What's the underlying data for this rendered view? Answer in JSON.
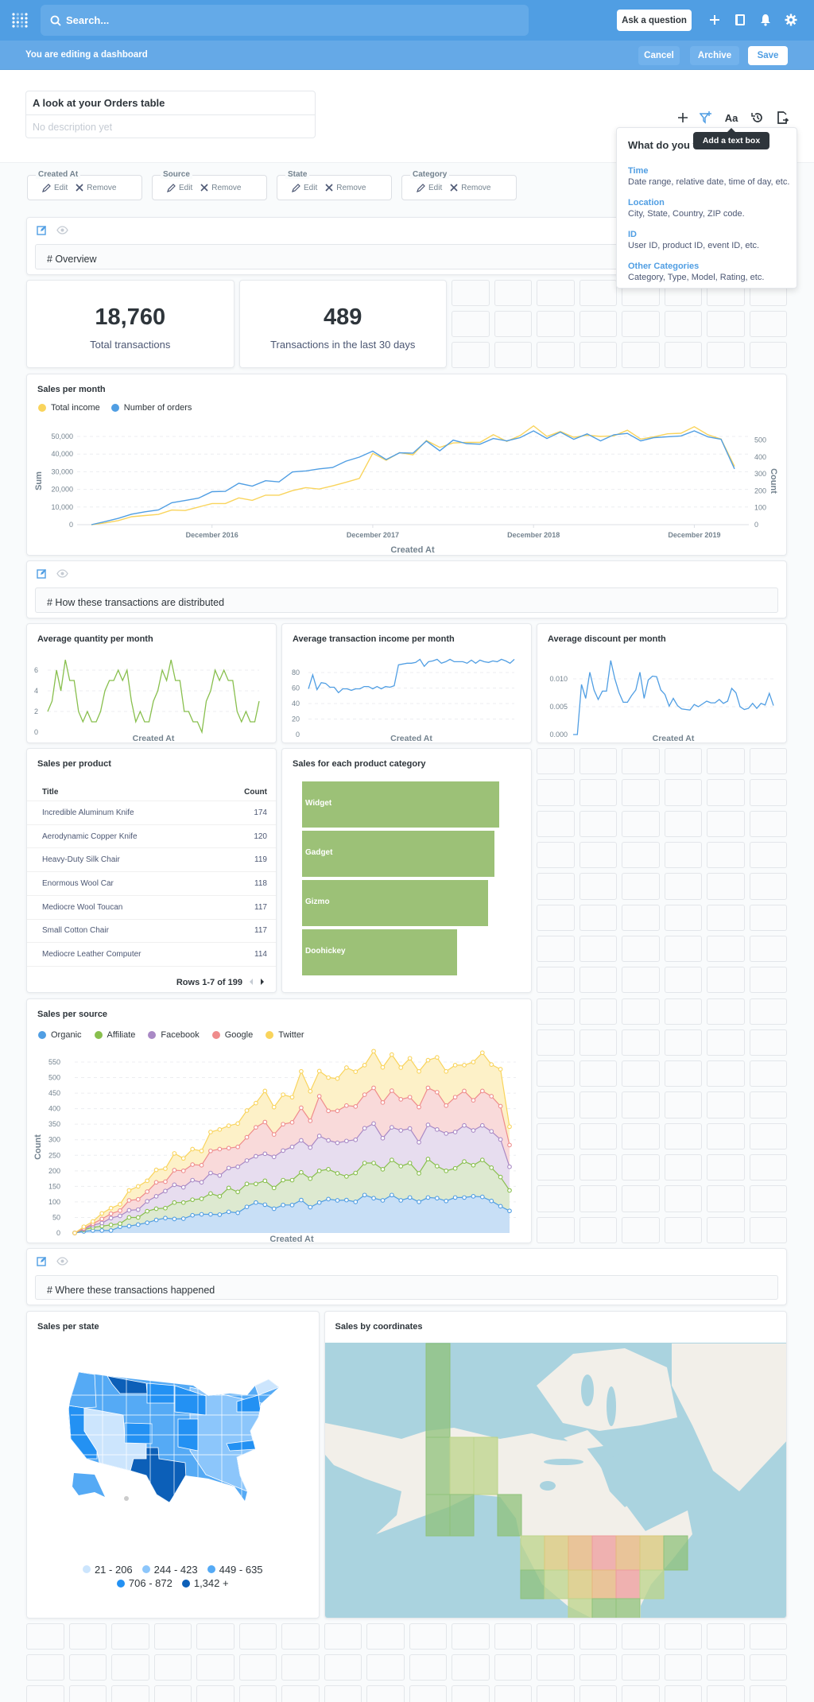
{
  "nav": {
    "search_placeholder": "Search...",
    "ask_button": "Ask a question",
    "icons": [
      "metabase-logo-icon",
      "search-icon",
      "plus-icon",
      "book-icon",
      "bell-icon",
      "gear-icon"
    ]
  },
  "editbar": {
    "message": "You are editing a dashboard",
    "cancel": "Cancel",
    "archive": "Archive",
    "save": "Save"
  },
  "dashboard": {
    "title": "A look at your Orders table",
    "description_placeholder": "No description yet"
  },
  "toolbar": {
    "icons": [
      "plus-icon",
      "add-filter-icon",
      "text-box-icon",
      "history-icon",
      "export-icon"
    ],
    "tooltip": "Add a text box"
  },
  "popover": {
    "heading": "What do you w",
    "options": [
      {
        "label": "Time",
        "desc": "Date range, relative date, time of day, etc."
      },
      {
        "label": "Location",
        "desc": "City, State, Country, ZIP code."
      },
      {
        "label": "ID",
        "desc": "User ID, product ID, event ID, etc."
      },
      {
        "label": "Other Categories",
        "desc": "Category, Type, Model, Rating, etc."
      }
    ]
  },
  "filters": {
    "edit_label": "Edit",
    "remove_label": "Remove",
    "items": [
      {
        "label": "Created At"
      },
      {
        "label": "Source"
      },
      {
        "label": "State"
      },
      {
        "label": "Category"
      }
    ]
  },
  "text_cards": [
    {
      "text": "# Overview"
    },
    {
      "text": "# How these transactions are distributed"
    },
    {
      "text": "# Where these transactions happened"
    }
  ],
  "scalars": [
    {
      "value": "18,760",
      "label": "Total transactions"
    },
    {
      "value": "489",
      "label": "Transactions in the last 30 days"
    }
  ],
  "colors": {
    "brand": "#509ee3",
    "yellow": "#f9d45c",
    "green": "#88bf4d",
    "purple": "#a989c5",
    "red": "#ef8c8c"
  },
  "chart_data": [
    {
      "title": "Sales per month",
      "type": "line",
      "x": [
        "2016-03",
        "2016-04",
        "2016-05",
        "2016-06",
        "2016-07",
        "2016-08",
        "2016-09",
        "2016-10",
        "2016-11",
        "2016-12",
        "2017-01",
        "2017-02",
        "2017-03",
        "2017-04",
        "2017-05",
        "2017-06",
        "2017-07",
        "2017-08",
        "2017-09",
        "2017-10",
        "2017-11",
        "2017-12",
        "2018-01",
        "2018-02",
        "2018-03",
        "2018-04",
        "2018-05",
        "2018-06",
        "2018-07",
        "2018-08",
        "2018-09",
        "2018-10",
        "2018-11",
        "2018-12",
        "2019-01",
        "2019-02",
        "2019-03",
        "2019-04",
        "2019-05",
        "2019-06",
        "2019-07",
        "2019-08",
        "2019-09",
        "2019-10",
        "2019-11",
        "2019-12",
        "2020-01",
        "2020-02",
        "2020-03"
      ],
      "xticks": [
        "December 2016",
        "December 2017",
        "December 2018",
        "December 2019"
      ],
      "xlabel": "Created At",
      "ylabel": "Sum",
      "y2label": "Count",
      "yticks": [
        "0",
        "10,000",
        "20,000",
        "30,000",
        "40,000",
        "50,000"
      ],
      "y2ticks": [
        "0",
        "100",
        "200",
        "300",
        "400",
        "500"
      ],
      "legend": "top-left",
      "series": [
        {
          "name": "Total income",
          "color": "#f9d45c",
          "axis": "left",
          "values": [
            0,
            1000,
            2300,
            4500,
            5200,
            5800,
            8300,
            8000,
            10000,
            12000,
            12000,
            15200,
            13800,
            16700,
            16700,
            19300,
            21000,
            20200,
            22000,
            24000,
            26200,
            40400,
            36500,
            40800,
            39600,
            47700,
            43800,
            46300,
            46600,
            46600,
            51000,
            47200,
            50500,
            56000,
            50000,
            52800,
            49500,
            50700,
            50000,
            50300,
            53500,
            48500,
            49800,
            51500,
            51800,
            55500,
            51000,
            48500,
            33000
          ]
        },
        {
          "name": "Number of orders",
          "color": "#509ee3",
          "axis": "right",
          "values": [
            0,
            18,
            37,
            62,
            76,
            87,
            130,
            143,
            157,
            195,
            197,
            245,
            228,
            260,
            253,
            312,
            318,
            330,
            338,
            376,
            400,
            435,
            385,
            425,
            423,
            495,
            437,
            500,
            480,
            476,
            510,
            496,
            515,
            555,
            510,
            548,
            505,
            537,
            496,
            532,
            540,
            496,
            515,
            520,
            525,
            555,
            520,
            505,
            330
          ]
        }
      ]
    },
    {
      "title": "Average quantity per month",
      "type": "line",
      "xlabel": "Created At",
      "yticks": [
        "0",
        "2",
        "4",
        "6"
      ],
      "color": "#88bf4d",
      "values": [
        2,
        3,
        6,
        4,
        7,
        5,
        5,
        2,
        1,
        2,
        1,
        1,
        2,
        4,
        5,
        5,
        6,
        5,
        6,
        3,
        1,
        2,
        1,
        1,
        3,
        4,
        6,
        5,
        7,
        5,
        5,
        2,
        2,
        1,
        1,
        0,
        3,
        4,
        6,
        5,
        6,
        5,
        5,
        2,
        1,
        2,
        1,
        1,
        3
      ]
    },
    {
      "title": "Average transaction income per month",
      "type": "line",
      "xlabel": "Created At",
      "yticks": [
        "0",
        "20",
        "40",
        "60",
        "80"
      ],
      "color": "#509ee3",
      "values": [
        59,
        77,
        58,
        67,
        66,
        61,
        61,
        54,
        59,
        59,
        57,
        59,
        59,
        62,
        62,
        59,
        62,
        59,
        62,
        61,
        63,
        90,
        91,
        92,
        92,
        93,
        97,
        88,
        94,
        95,
        97,
        92,
        94,
        97,
        94,
        94,
        94,
        92,
        96,
        92,
        96,
        94,
        93,
        95,
        94,
        97,
        95,
        92,
        97
      ]
    },
    {
      "title": "Average discount per month",
      "type": "line",
      "xlabel": "Created At",
      "yticks": [
        "0.000",
        "0.005",
        "0.010"
      ],
      "color": "#509ee3",
      "values": [
        0,
        0,
        0.009,
        0.0065,
        0.0112,
        0.008,
        0.0063,
        0.0078,
        0.0078,
        0.0133,
        0.01,
        0.0075,
        0.0058,
        0.0058,
        0.007,
        0.008,
        0.0112,
        0.0065,
        0.0098,
        0.0105,
        0.0104,
        0.008,
        0.0072,
        0.0051,
        0.0065,
        0.0052,
        0.0046,
        0.0045,
        0.0044,
        0.0054,
        0.005,
        0.0055,
        0.006,
        0.0057,
        0.0057,
        0.0063,
        0.0056,
        0.006,
        0.0083,
        0.0075,
        0.005,
        0.0045,
        0.0047,
        0.0056,
        0.0047,
        0.0056,
        0.0053,
        0.0074,
        0.0052
      ]
    },
    {
      "title": "Sales per product",
      "type": "table",
      "columns": [
        "Title",
        "Count"
      ],
      "rows": [
        [
          "Incredible Aluminum Knife",
          "174"
        ],
        [
          "Aerodynamic Copper Knife",
          "120"
        ],
        [
          "Heavy-Duty Silk Chair",
          "119"
        ],
        [
          "Enormous Wool Car",
          "118"
        ],
        [
          "Mediocre Wool Toucan",
          "117"
        ],
        [
          "Small Cotton Chair",
          "117"
        ],
        [
          "Mediocre Leather Computer",
          "114"
        ]
      ],
      "pagination": "Rows 1-7 of 199"
    },
    {
      "title": "Sales for each product category",
      "type": "bar",
      "orientation": "horizontal",
      "color": "#9cc177",
      "categories": [
        "Widget",
        "Gadget",
        "Gizmo",
        "Doohickey"
      ],
      "values": [
        5061,
        4939,
        4784,
        3976
      ]
    },
    {
      "title": "Sales per source",
      "type": "area",
      "stacked": true,
      "xlabel": "Created At",
      "ylabel": "Count",
      "legend": "top-left",
      "yticks": [
        "0",
        "50",
        "100",
        "150",
        "200",
        "250",
        "300",
        "350",
        "400",
        "450",
        "500",
        "550"
      ],
      "series": [
        {
          "name": "Organic",
          "color": "#509ee3",
          "values": [
            0,
            5,
            8,
            8,
            8,
            20,
            22,
            27,
            33,
            42,
            48,
            45,
            46,
            57,
            60,
            60,
            59,
            68,
            65,
            84,
            98,
            91,
            78,
            90,
            90,
            106,
            83,
            98,
            109,
            105,
            106,
            100,
            122,
            112,
            105,
            122,
            105,
            114,
            100,
            114,
            112,
            103,
            114,
            114,
            118,
            116,
            103,
            86,
            71
          ]
        },
        {
          "name": "Affiliate",
          "color": "#88bf4d",
          "values": [
            0,
            5,
            10,
            14,
            18,
            10,
            28,
            23,
            37,
            36,
            32,
            53,
            52,
            50,
            50,
            67,
            59,
            77,
            67,
            74,
            60,
            77,
            67,
            80,
            80,
            89,
            92,
            102,
            96,
            87,
            76,
            93,
            103,
            113,
            100,
            113,
            110,
            111,
            92,
            124,
            103,
            97,
            94,
            116,
            100,
            119,
            107,
            94,
            66
          ]
        },
        {
          "name": "Facebook",
          "color": "#a989c5",
          "values": [
            0,
            2,
            7,
            10,
            22,
            25,
            23,
            25,
            32,
            40,
            55,
            57,
            49,
            63,
            53,
            66,
            67,
            64,
            81,
            75,
            89,
            87,
            100,
            95,
            107,
            103,
            100,
            112,
            93,
            98,
            114,
            107,
            112,
            127,
            100,
            105,
            115,
            111,
            100,
            110,
            118,
            120,
            117,
            116,
            112,
            111,
            117,
            121,
            76
          ]
        },
        {
          "name": "Google",
          "color": "#ef8c8c",
          "values": [
            0,
            3,
            5,
            13,
            14,
            17,
            32,
            33,
            31,
            45,
            30,
            47,
            53,
            50,
            55,
            71,
            85,
            64,
            64,
            75,
            93,
            102,
            72,
            85,
            79,
            105,
            86,
            128,
            95,
            103,
            114,
            107,
            108,
            115,
            115,
            118,
            100,
            101,
            113,
            119,
            120,
            90,
            112,
            111,
            97,
            111,
            113,
            107,
            70
          ]
        },
        {
          "name": "Twitter",
          "color": "#f9d45c",
          "values": [
            0,
            5,
            7,
            18,
            18,
            20,
            32,
            42,
            35,
            40,
            42,
            54,
            40,
            50,
            46,
            61,
            63,
            72,
            75,
            86,
            78,
            100,
            88,
            95,
            81,
            117,
            95,
            81,
            107,
            104,
            122,
            112,
            95,
            118,
            113,
            116,
            102,
            125,
            115,
            89,
            112,
            110,
            103,
            83,
            123,
            123,
            102,
            119,
            59
          ]
        }
      ]
    },
    {
      "title": "Sales per state",
      "type": "map",
      "region": "us_states",
      "legend": "bottom",
      "bins": [
        {
          "label": "21 - 206",
          "color": "#cce5fd"
        },
        {
          "label": "244 - 423",
          "color": "#8cc6fb"
        },
        {
          "label": "449 - 635",
          "color": "#55aaf5"
        },
        {
          "label": "706 - 872",
          "color": "#2391f3"
        },
        {
          "label": "1,342 +",
          "color": "#0c5fb8"
        }
      ]
    },
    {
      "title": "Sales by coordinates",
      "type": "map",
      "style": "grid heatmap"
    }
  ]
}
